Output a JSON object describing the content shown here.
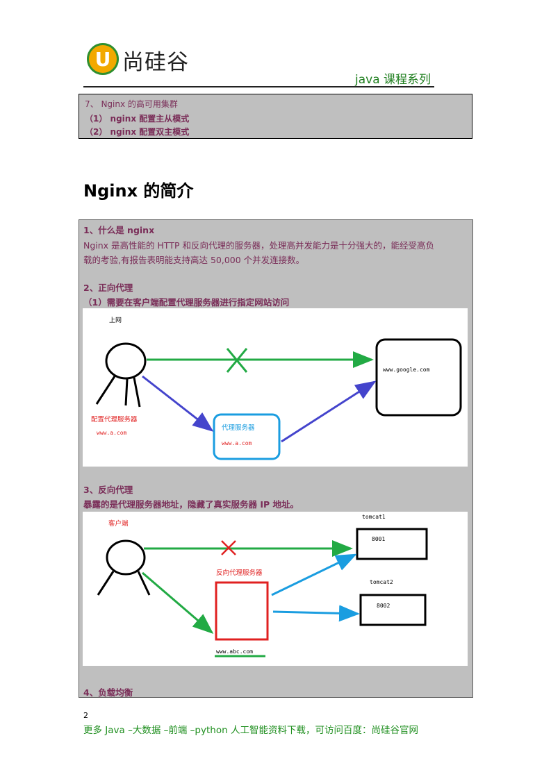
{
  "header": {
    "logo_letter": "U",
    "logo_text": "尚硅谷",
    "series": "java 课程系列"
  },
  "toc": {
    "line1": "7、 Nginx 的高可用集群",
    "line2": "（1）   nginx 配置主从模式",
    "line3": "（2）   nginx 配置双主模式"
  },
  "title": "Nginx 的简介",
  "section1": {
    "heading": "1、什么是 nginx",
    "para_line1": "Nginx 是高性能的 HTTP 和反向代理的服务器，处理高并发能力是十分强大的，能经受高负",
    "para_line2": "载的考验,有报告表明能支持高达 50,000 个并发连接数。"
  },
  "section2": {
    "heading": "2、正向代理",
    "subheading": "（1）需要在客户端配置代理服务器进行指定网站访问",
    "diagram": {
      "label_internet": "上网",
      "label_client_config": "配置代理服务器",
      "label_client_url": "www.a.com",
      "label_proxy": "代理服务器",
      "label_proxy_url": "www.a.com",
      "label_target": "www.google.com"
    }
  },
  "section3": {
    "heading": "3、反向代理",
    "subheading": "暴露的是代理服务器地址，隐藏了真实服务器 IP 地址。",
    "diagram": {
      "label_client": "客户端",
      "label_reverse_proxy": "反向代理服务器",
      "label_proxy_url": "www.abc.com",
      "label_tomcat1": "tomcat1",
      "label_port1": "8001",
      "label_tomcat2": "tomcat2",
      "label_port2": "8002"
    }
  },
  "section4": {
    "heading": "4、负载均衡"
  },
  "footer": {
    "page_number": "2",
    "text": "更多 Java –大数据 –前端 –python 人工智能资料下载，可访问百度：尚硅谷官网"
  },
  "colors": {
    "accent_text": "#7a2d58",
    "green": "#22aa44",
    "blue": "#4444cc",
    "cyan": "#1a9de0",
    "red": "#e02020"
  }
}
